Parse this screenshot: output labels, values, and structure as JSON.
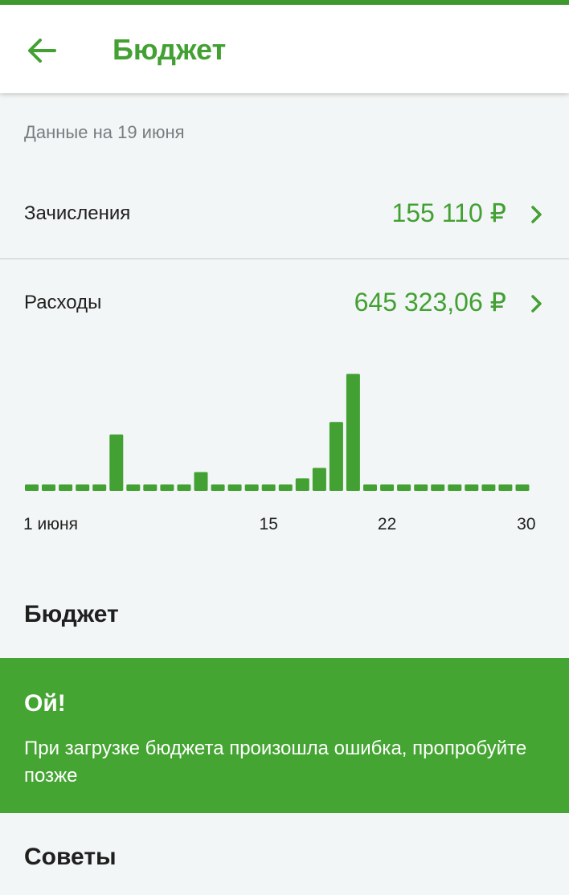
{
  "header": {
    "title": "Бюджет",
    "back_icon": "arrow-left-icon"
  },
  "colors": {
    "accent": "#43a033",
    "error_card": "#45a532",
    "background": "#f3f6f6"
  },
  "date_note": "Данные на 19 июня",
  "income": {
    "label": "Зачисления",
    "value": "155 110 ₽"
  },
  "expenses": {
    "label": "Расходы",
    "value": "645 323,06 ₽"
  },
  "chart_data": {
    "type": "bar",
    "categories": [
      "1",
      "2",
      "3",
      "4",
      "5",
      "6",
      "7",
      "8",
      "9",
      "10",
      "11",
      "12",
      "13",
      "14",
      "15",
      "16",
      "17",
      "18",
      "19",
      "20",
      "21",
      "22",
      "23",
      "24",
      "25",
      "26",
      "27",
      "28",
      "29",
      "30"
    ],
    "values": [
      0,
      0,
      0,
      0,
      0,
      0.27,
      0,
      0.02,
      0,
      0,
      0.09,
      0,
      0,
      0,
      0,
      0,
      0.06,
      0.11,
      0.33,
      0.56,
      0,
      0,
      0,
      0,
      0,
      0,
      0,
      0,
      0,
      0
    ],
    "x_tick_labels": [
      "1 июня",
      "15",
      "22",
      "30"
    ],
    "grid": false,
    "legend": "none"
  },
  "budget_section": {
    "title": "Бюджет",
    "error_title": "Ой!",
    "error_text": "При загрузке бюджета произошла ошибка, пропробуйте позже"
  },
  "tips_section": {
    "title": "Советы"
  }
}
